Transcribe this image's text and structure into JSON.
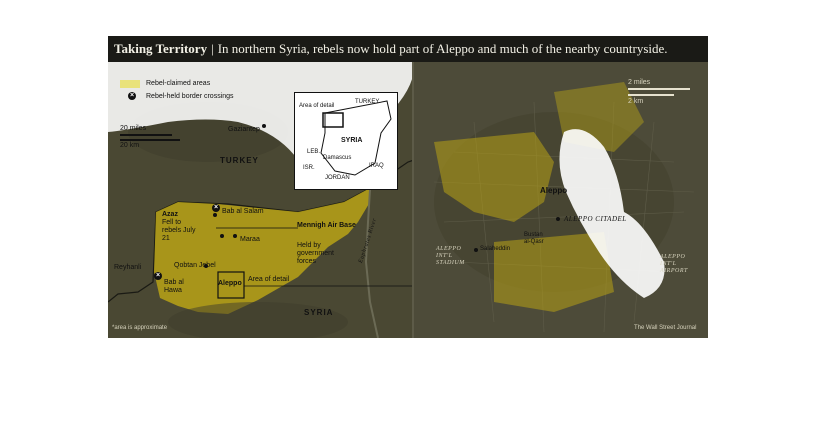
{
  "title": {
    "main": "Taking Territory",
    "separator": "|",
    "subtitle": "In northern Syria, rebels now hold part of Aleppo and much of the nearby countryside."
  },
  "legend": {
    "rebel_areas": "Rebel-claimed areas",
    "crossings": "Rebel-held border crossings",
    "swatch_color": "#e9e27a",
    "crossing_icon": "x-circle-icon"
  },
  "left_map": {
    "scale_miles": "20 miles",
    "scale_km": "20 km",
    "country_turkey": "TURKEY",
    "country_syria": "SYRIA",
    "places": {
      "gaziantep": "Gaziantep",
      "bab_al_salam": "Bab al Salam",
      "azaz": "Azaz",
      "azaz_note": "Fell to rebels July 21",
      "marea": "Maraa",
      "mennigh": "Mennigh Air Base",
      "mennigh_note": "Held by government forces",
      "reyhanli": "Reyhanli",
      "qobtan_jebel": "Qobtan Jebel",
      "bab_al_hawa": "Bab al Hawa",
      "aleppo": "Aleppo",
      "area_of_detail": "Area of detail",
      "euphrates": "Euphrates River"
    },
    "footnote": "*area is approximate"
  },
  "inset": {
    "area_of_detail": "Area of detail",
    "turkey": "TURKEY",
    "syria": "SYRIA",
    "leb": "LEB.",
    "isr": "ISR.",
    "damascus": "Damascus",
    "iraq": "IRAQ",
    "jordan": "JORDAN"
  },
  "right_map": {
    "scale_miles": "2 miles",
    "scale_km": "2 km",
    "aleppo": "Aleppo",
    "citadel": "ALEPPO CITADEL",
    "stadium_line1": "ALEPPO",
    "stadium_line2": "INT'L",
    "stadium_line3": "STADIUM",
    "salaheddin": "Salaheddin",
    "bustan": "Bustan al-Qasr",
    "airport_line1": "ALEPPO",
    "airport_line2": "INT'L",
    "airport_line3": "AIRPORT",
    "credit": "The Wall Street Journal"
  },
  "colors": {
    "rebel_fill": "#b8a316",
    "highlight": "#ffffff"
  }
}
